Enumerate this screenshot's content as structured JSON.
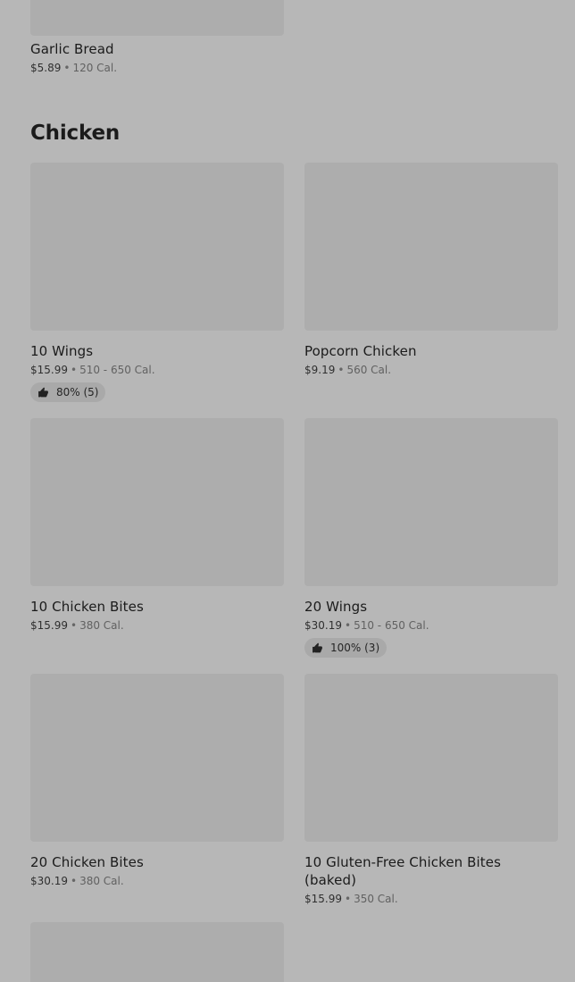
{
  "previous_item": {
    "name": "Garlic Bread",
    "price": "$5.89",
    "separator": "•",
    "calories": "120 Cal."
  },
  "section": {
    "title": "Chicken"
  },
  "items": [
    {
      "name": "10 Wings",
      "price": "$15.99",
      "separator": "•",
      "calories": "510 - 650 Cal.",
      "rating": "80% (5)"
    },
    {
      "name": "Popcorn Chicken",
      "price": "$9.19",
      "separator": "•",
      "calories": "560 Cal."
    },
    {
      "name": "10 Chicken Bites",
      "price": "$15.99",
      "separator": "•",
      "calories": "380 Cal."
    },
    {
      "name": "20 Wings",
      "price": "$30.19",
      "separator": "•",
      "calories": "510 - 650 Cal.",
      "rating": "100% (3)"
    },
    {
      "name": "20 Chicken Bites",
      "price": "$30.19",
      "separator": "•",
      "calories": "380 Cal."
    },
    {
      "name": "10 Gluten-Free Chicken Bites (baked)",
      "price": "$15.99",
      "separator": "•",
      "calories": "350 Cal."
    }
  ],
  "icons": {
    "rating": "thumbs-up-icon"
  },
  "colors": {
    "background": "#b7b7b7",
    "image_placeholder": "#adadad",
    "rating_badge": "#a9a9a9"
  }
}
